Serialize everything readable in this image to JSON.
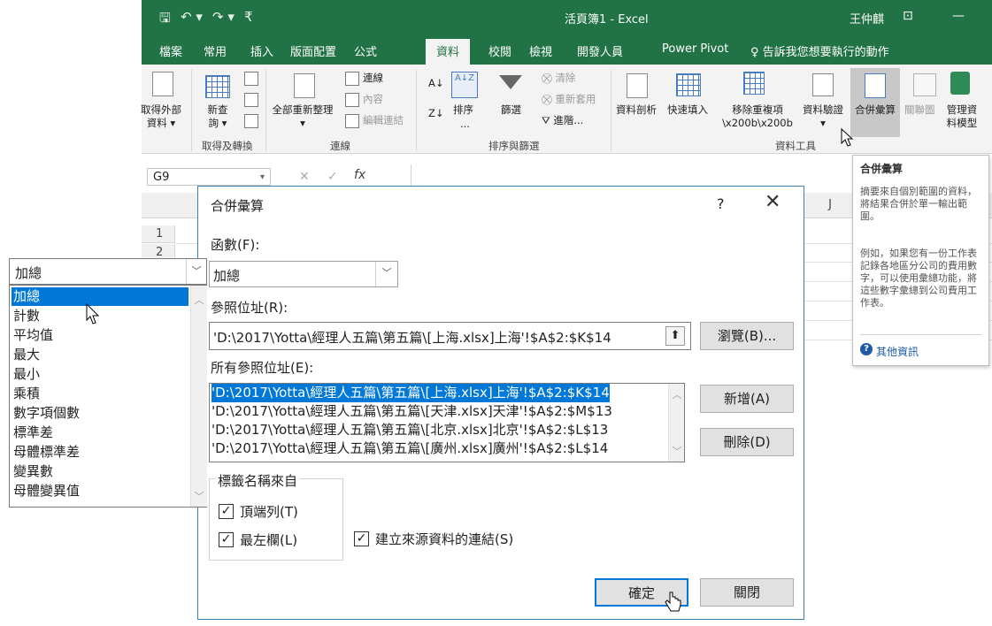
{
  "titlebar": {
    "window_title": "活頁簿1 - Excel",
    "user": "王仲麒",
    "save_icon": "save-icon",
    "undo_icon": "undo-icon",
    "redo_icon": "redo-icon"
  },
  "tabs": [
    "檔案",
    "常用",
    "插入",
    "版面配置",
    "公式",
    "資料",
    "校閱",
    "檢視",
    "開發人員",
    "Power Pivot",
    "♀ 告訴我您想要執行的動作"
  ],
  "active_tab": "資料",
  "ribbon": {
    "get_external_line1": "取得外部",
    "get_external_line2": "資料 ▾",
    "new_query_line1": "新查",
    "new_query_line2": "詢 ▾",
    "group_get_transform": "取得及轉換",
    "refresh_all": "全部重新整理",
    "refresh_arrow": "▾",
    "connections": "連線",
    "properties": "內容",
    "edit_links": "編輯連結",
    "group_connections": "連線",
    "sort_az": "A↓Z",
    "sort": "排序",
    "filter": "篩選",
    "clear": "清除",
    "reapply": "重新套用",
    "advanced": "進階...",
    "sort_more": "...",
    "group_sort_filter": "排序與篩選",
    "text_to_columns": "資料剖析",
    "flash_fill": "快速填入",
    "remove_dup_line1": "移除重複項",
    "remove_dup_line2": "\\x200b\\x200b",
    "data_validation": "資料驗證",
    "data_validation_arrow": "▾",
    "consolidate": "合併彙算",
    "relationships": "關聯圖",
    "manage_model_line1": "管理資",
    "manage_model_line2": "料模型",
    "group_data_tools": "資料工具"
  },
  "formula_bar": {
    "name_box": "G9",
    "fx": "fx"
  },
  "grid": {
    "col_j": "J",
    "rows": [
      "1",
      "2"
    ]
  },
  "tooltip": {
    "title": "合併彙算",
    "p1": "摘要來自個別範圍的資料，將結果合併於單一輸出範圍。",
    "p2": "例如，如果您有一份工作表記錄各地區分公司的費用數字，可以使用彙總功能，將這些數字彙總到公司費用工作表。",
    "more": "其他資訊"
  },
  "dialog": {
    "title": "合併彙算",
    "help": "?",
    "close": "✕",
    "function_label": "函數(F):",
    "function_value": "加總",
    "reference_label": "參照位址(R):",
    "reference_value": "'D:\\2017\\Yotta\\經理人五篇\\第五篇\\[上海.xlsx]上海'!$A$2:$K$14",
    "browse": "瀏覽(B)...",
    "all_refs_label": "所有參照位址(E):",
    "all_refs": [
      "'D:\\2017\\Yotta\\經理人五篇\\第五篇\\[上海.xlsx]上海'!$A$2:$K$14",
      "'D:\\2017\\Yotta\\經理人五篇\\第五篇\\[天津.xlsx]天津'!$A$2:$M$13",
      "'D:\\2017\\Yotta\\經理人五篇\\第五篇\\[北京.xlsx]北京'!$A$2:$L$13",
      "'D:\\2017\\Yotta\\經理人五篇\\第五篇\\[廣州.xlsx]廣州'!$A$2:$L$14"
    ],
    "add": "新增(A)",
    "delete": "刪除(D)",
    "use_labels_legend": "標籤名稱來自",
    "top_row": "頂端列(T)",
    "left_column": "最左欄(L)",
    "create_links": "建立來源資料的連結(S)",
    "ok": "確定",
    "close_btn": "關閉",
    "top_row_checked": true,
    "left_column_checked": true,
    "create_links_checked": true
  },
  "function_dropdown": {
    "value": "加總",
    "options": [
      "加總",
      "計數",
      "平均值",
      "最大",
      "最小",
      "乘積",
      "數字項個數",
      "標準差",
      "母體標準差",
      "變異數",
      "母體變異值"
    ],
    "selected_index": 0
  }
}
